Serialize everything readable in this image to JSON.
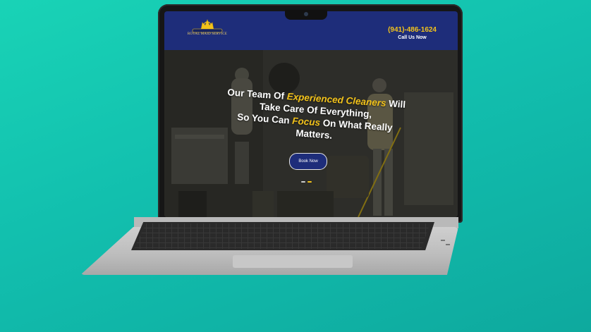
{
  "header": {
    "logo_text": "ROYAL MAID SERVICE",
    "phone": "(941)-486-1624",
    "call_label": "Call Us Now"
  },
  "hero": {
    "line1_a": "Our Team Of ",
    "line1_highlight": "Experienced Cleaners",
    "line1_b": " Will",
    "line2": "Take Care Of Everything,",
    "line3_a": "So You Can ",
    "line3_highlight": "Focus",
    "line3_b": " On What Really",
    "line4": "Matters.",
    "button_label": "Book Now"
  },
  "colors": {
    "brand_blue": "#1e2d7a",
    "accent_yellow": "#f2c21b",
    "background_teal": "#14c9b0"
  }
}
